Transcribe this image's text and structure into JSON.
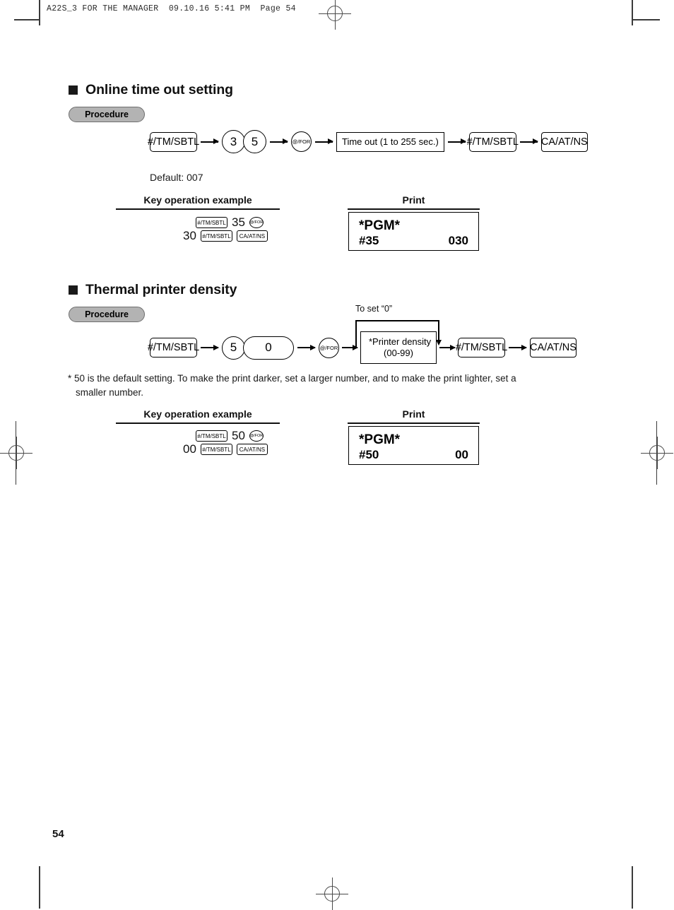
{
  "page": {
    "header_line": "A22S_3 FOR THE MANAGER  09.10.16 5:41 PM  Page 54",
    "page_number": "54"
  },
  "sections": [
    {
      "title": "Online time out setting",
      "procedure_label": "Procedure",
      "flow": [
        {
          "type": "key-rect",
          "label": "#/TM/SBTL"
        },
        {
          "type": "arrow"
        },
        {
          "type": "circle",
          "label": "3"
        },
        {
          "type": "circle",
          "label": "5"
        },
        {
          "type": "arrow"
        },
        {
          "type": "for-key",
          "label": "@/FOR"
        },
        {
          "type": "arrow"
        },
        {
          "type": "box",
          "label": "Time out (1 to 255 sec.)"
        },
        {
          "type": "arrow"
        },
        {
          "type": "key-rect",
          "label": "#/TM/SBTL"
        },
        {
          "type": "arrow"
        },
        {
          "type": "key-rect",
          "label": "CA/AT/NS"
        }
      ],
      "default_text": "Default: 007",
      "key_example_header": "Key operation example",
      "print_header": "Print",
      "example_rows": [
        [
          {
            "type": "chip-tm",
            "label": "#/TM/SBTL"
          },
          {
            "type": "num",
            "label": "35"
          },
          {
            "type": "chip-for",
            "label": "@/FOR"
          }
        ],
        [
          {
            "type": "num",
            "label": "30"
          },
          {
            "type": "chip-tm",
            "label": "#/TM/SBTL"
          },
          {
            "type": "chip-ca",
            "label": "CA/AT/NS"
          }
        ]
      ],
      "print": {
        "title": "*PGM*",
        "code": "#35",
        "value": "030"
      }
    },
    {
      "title": "Thermal printer density",
      "procedure_label": "Procedure",
      "bypass_label": "To set “0”",
      "flow": [
        {
          "type": "key-rect",
          "label": "#/TM/SBTL"
        },
        {
          "type": "arrow"
        },
        {
          "type": "circle",
          "label": "5"
        },
        {
          "type": "pill",
          "label": "0"
        },
        {
          "type": "arrow"
        },
        {
          "type": "for-key",
          "label": "@/FOR"
        },
        {
          "type": "arrow"
        },
        {
          "type": "box-2line",
          "label_top": "*Printer density",
          "label_bottom": "(00-99)"
        },
        {
          "type": "arrow"
        },
        {
          "type": "key-rect",
          "label": "#/TM/SBTL"
        },
        {
          "type": "arrow"
        },
        {
          "type": "key-rect",
          "label": "CA/AT/NS"
        }
      ],
      "footnote_line1": "* 50 is the default setting.  To make the print darker, set a larger number, and to make the print lighter, set a",
      "footnote_line2": "smaller number.",
      "key_example_header": "Key operation example",
      "print_header": "Print",
      "example_rows": [
        [
          {
            "type": "chip-tm",
            "label": "#/TM/SBTL"
          },
          {
            "type": "num",
            "label": "50"
          },
          {
            "type": "chip-for",
            "label": "@/FOR"
          }
        ],
        [
          {
            "type": "num",
            "label": "00"
          },
          {
            "type": "chip-tm",
            "label": "#/TM/SBTL"
          },
          {
            "type": "chip-ca",
            "label": "CA/AT/NS"
          }
        ]
      ],
      "print": {
        "title": "*PGM*",
        "code": "#50",
        "value": "00"
      }
    }
  ]
}
